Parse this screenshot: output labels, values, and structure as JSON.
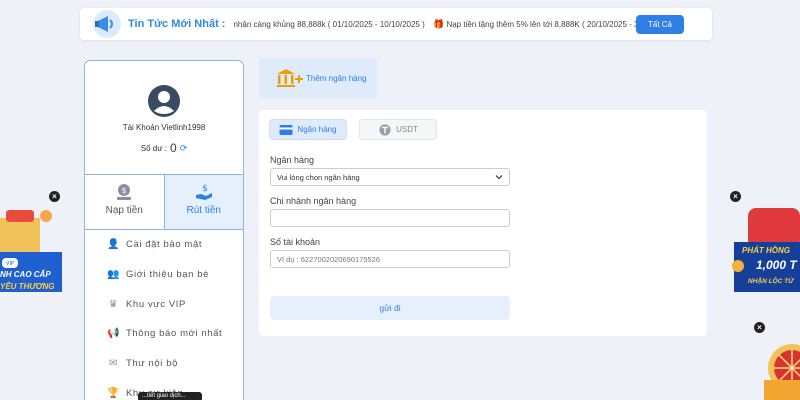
{
  "ticker": {
    "label": "Tin Tức Mới Nhất :",
    "message_1": "nhận càng khủng 88,888k ( 01/10/2025 - 10/10/2025 )",
    "message_2": "Nạp tiền tặng thêm 5% lên tới 8,888K ( 20/10/2025 - 30",
    "all_button": "Tất Cả"
  },
  "profile": {
    "account": "Tài Khoản Vietlinh1998",
    "balance_label": "Số dư :",
    "balance_value": "0"
  },
  "actions": {
    "deposit": "Nạp tiền",
    "withdraw": "Rút tiền"
  },
  "menu": [
    {
      "label": "Cài đặt bảo mật",
      "icon": "user-gear-icon"
    },
    {
      "label": "Giới thiệu bạn bè",
      "icon": "users-icon"
    },
    {
      "label": "Khu vực VIP",
      "icon": "crown-icon"
    },
    {
      "label": "Thông báo mới nhất",
      "icon": "megaphone-icon"
    },
    {
      "label": "Thư nội bộ",
      "icon": "mail-icon"
    },
    {
      "label": "Khu sự kiện",
      "icon": "trophy-icon"
    }
  ],
  "tooltip_fragment": "...tiết giao dịch...",
  "add_bank": "Thêm ngân hàng",
  "tabs": {
    "bank": "Ngân hàng",
    "usdt": "USDT"
  },
  "form": {
    "bank_label": "Ngân hàng",
    "bank_select": "Vui lòng chọn ngân hàng",
    "branch_label": "Chi nhánh ngân hàng",
    "branch_value": "",
    "account_label": "Số tài khoản",
    "account_placeholder": "Ví dụ : 6227002020690175526",
    "submit": "gửi đi"
  },
  "promo_left": {
    "line_1": "NH CAO CẤP",
    "line_2": "YÊU THƯƠNG"
  },
  "promo_right": {
    "line_1": "PHÁT HỒNG",
    "line_2": "1,000 T",
    "line_3": "NHẬN LỘC TỨ"
  },
  "colors": {
    "accent": "#2f7fe6",
    "panel_border": "#8cb6ea",
    "tab_active_bg": "#dfeafa",
    "background": "#eef2f8"
  }
}
